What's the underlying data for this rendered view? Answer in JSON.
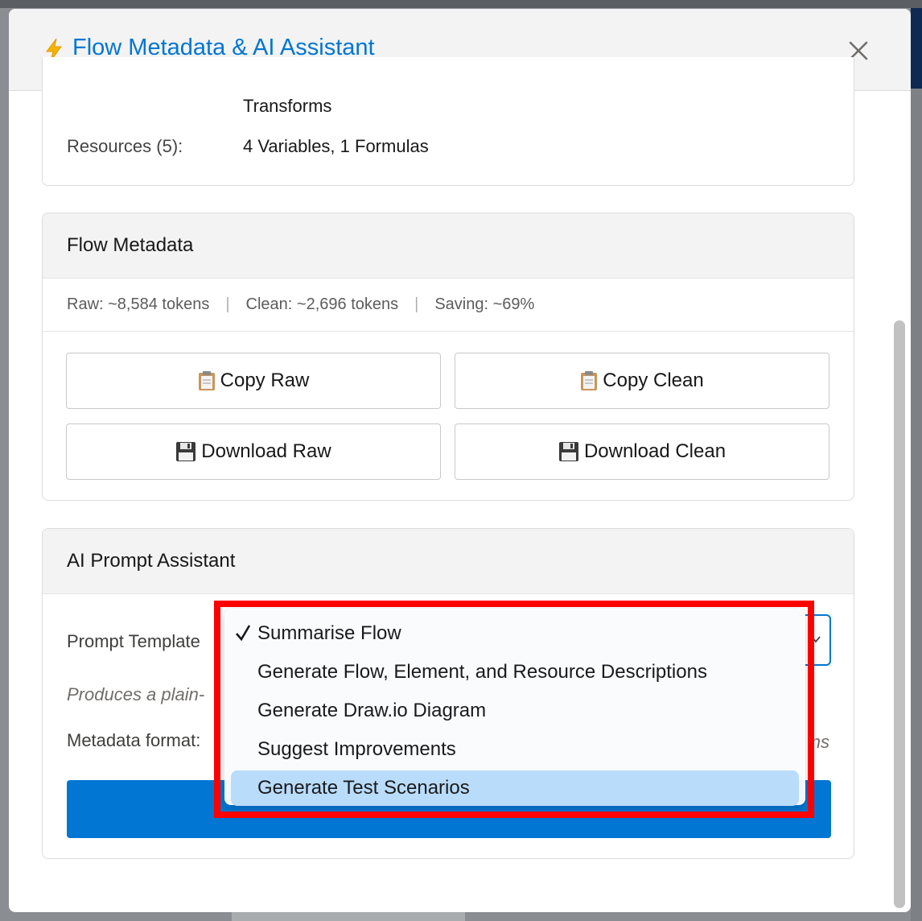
{
  "modal": {
    "title": "Flow Metadata & AI Assistant",
    "close_icon": "close-icon"
  },
  "summary": {
    "transforms": "Transforms",
    "resources_label": "Resources (5):",
    "resources_value": "4 Variables, 1 Formulas"
  },
  "metadata": {
    "title": "Flow Metadata",
    "raw_tokens": "Raw: ~8,584 tokens",
    "clean_tokens": "Clean: ~2,696 tokens",
    "saving": "Saving: ~69%",
    "separator": "|",
    "copy_raw": "Copy Raw",
    "copy_clean": "Copy Clean",
    "download_raw": "Download Raw",
    "download_clean": "Download Clean"
  },
  "ai": {
    "title": "AI Prompt Assistant",
    "template_label": "Prompt Template",
    "description": "Produces a plain-",
    "format_label": "Metadata format:",
    "format_ghost": "ns"
  },
  "dropdown": {
    "options": [
      "Summarise Flow",
      "Generate Flow, Element, and Resource Descriptions",
      "Generate Draw.io Diagram",
      "Suggest Improvements",
      "Generate Test Scenarios"
    ],
    "selected_index": 0,
    "highlighted_index": 4
  },
  "colors": {
    "accent": "#0176d3",
    "highlight": "#ff0000"
  }
}
